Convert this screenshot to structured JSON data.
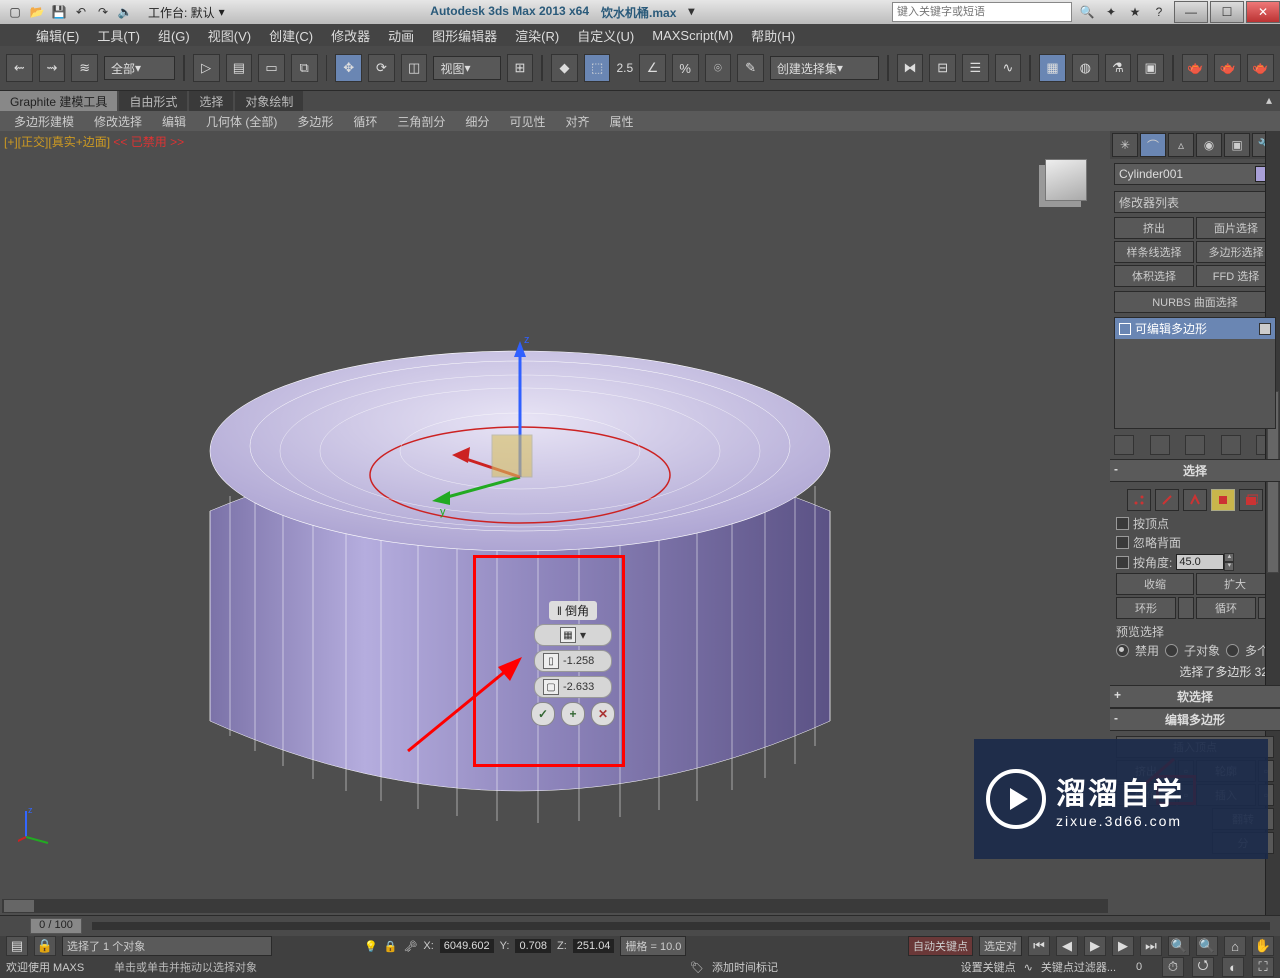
{
  "titlebar": {
    "workspace_label": "工作台: 默认",
    "app_title": "Autodesk 3ds Max  2013 x64",
    "filename": "饮水机桶.max",
    "search_placeholder": "键入关键字或短语"
  },
  "menus": [
    "编辑(E)",
    "工具(T)",
    "组(G)",
    "视图(V)",
    "创建(C)",
    "修改器",
    "动画",
    "图形编辑器",
    "渲染(R)",
    "自定义(U)",
    "MAXScript(M)",
    "帮助(H)"
  ],
  "toolbar": {
    "filter": "全部",
    "refcoord": "视图",
    "spinner": "2.5",
    "named_sel": "创建选择集"
  },
  "ribbon": {
    "tabs": [
      "Graphite 建模工具",
      "自由形式",
      "选择",
      "对象绘制"
    ],
    "sub": [
      "多边形建模",
      "修改选择",
      "编辑",
      "几何体 (全部)",
      "多边形",
      "循环",
      "三角剖分",
      "细分",
      "可见性",
      "对齐",
      "属性"
    ]
  },
  "viewport": {
    "label_pre": "[+][正交]",
    "label_mid": "[真实+边面]",
    "label_post": " << 已禁用 >>",
    "axes": {
      "z": "z",
      "y": "y"
    }
  },
  "caddy": {
    "title": "‖ 倒角",
    "v1": "-1.258",
    "v2": "-2.633"
  },
  "panel": {
    "name": "Cylinder001",
    "mod_placeholder": "修改器列表",
    "select_buttons": [
      [
        "挤出",
        "面片选择"
      ],
      [
        "样条线选择",
        "多边形选择"
      ],
      [
        "体积选择",
        "FFD 选择"
      ]
    ],
    "nurbs": "NURBS 曲面选择",
    "stack_item": "可编辑多边形",
    "roll_select": "选择",
    "chk_vertex": "按顶点",
    "chk_backface": "忽略背面",
    "chk_angle": "按角度:",
    "angle_val": "45.0",
    "shrink": "收缩",
    "grow": "扩大",
    "ring": "环形",
    "loop": "循环",
    "preview": "预览选择",
    "rad_off": "禁用",
    "rad_sub": "子对象",
    "rad_multi": "多个",
    "sel_count": "选择了多边形 32",
    "roll_soft": "软选择",
    "roll_editpoly": "编辑多边形",
    "insert_vertex": "插入顶点",
    "ep_r1a": "挤出",
    "ep_r1b": "轮廓",
    "ep_r2a": "倒角",
    "ep_r2b": "插入",
    "ep_r3": "翻转",
    "ep_r4": "分"
  },
  "timeline": {
    "frame": "0 / 100"
  },
  "status": {
    "selected": "选择了 1 个对象",
    "x_lbl": "X:",
    "x": "6049.602",
    "y_lbl": "Y:",
    "y": "0.708",
    "z_lbl": "Z:",
    "z": "251.04",
    "grid_lbl": "栅格 = 10.0",
    "autokey": "自动关键点",
    "selset": "选定对",
    "welcome": "欢迎使用  MAXS",
    "prompt": "单击或单击并拖动以选择对象",
    "addmark": "添加时间标记",
    "setkey": "设置关键点",
    "keyfilter": "关键点过滤器..."
  },
  "watermark": {
    "big": "溜溜自学",
    "small": "zixue.3d66.com"
  }
}
